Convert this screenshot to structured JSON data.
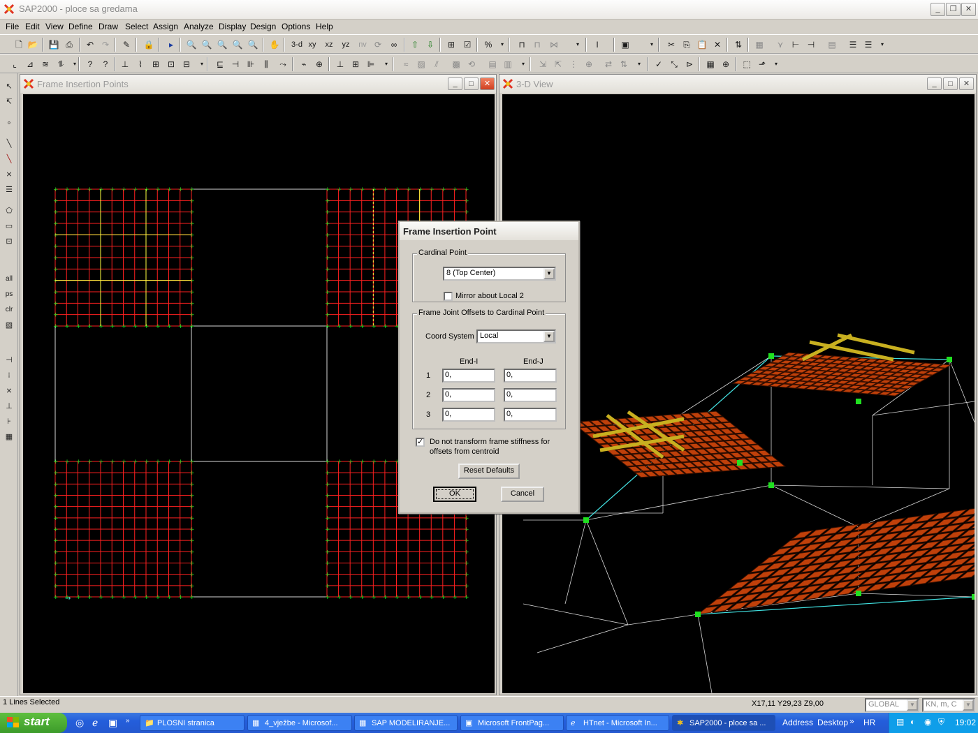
{
  "app": {
    "title": "SAP2000 - ploce sa gredama"
  },
  "menu": [
    "File",
    "Edit",
    "View",
    "Define",
    "Draw",
    "Select",
    "Assign",
    "Analyze",
    "Display",
    "Design",
    "Options",
    "Help"
  ],
  "toolbar1": {
    "view_3d": "3-d",
    "view_xy": "xy",
    "view_xz": "xz",
    "view_yz": "yz",
    "view_nv": "nv"
  },
  "left_toolbar": {
    "all": "all",
    "ps": "ps",
    "clr": "clr"
  },
  "window_left": {
    "title": "Frame Insertion Points"
  },
  "window_right": {
    "title": "3-D View"
  },
  "dialog": {
    "title": "Frame Insertion Point",
    "cardinal_group": "Cardinal Point",
    "cardinal_value": "8 (Top Center)",
    "mirror_label": "Mirror about Local 2",
    "mirror_checked": false,
    "offsets_group": "Frame Joint Offsets to Cardinal Point",
    "coord_label": "Coord System",
    "coord_value": "Local",
    "col_endi": "End-I",
    "col_endj": "End-J",
    "rows": [
      {
        "label": "1",
        "end_i": "0,",
        "end_j": "0,"
      },
      {
        "label": "2",
        "end_i": "0,",
        "end_j": "0,"
      },
      {
        "label": "3",
        "end_i": "0,",
        "end_j": "0,"
      }
    ],
    "transform_label_1": "Do not transform frame stiffness for",
    "transform_label_2": "offsets from centroid",
    "transform_checked": true,
    "reset_label": "Reset Defaults",
    "ok_label": "OK",
    "cancel_label": "Cancel"
  },
  "status": {
    "left": "1 Lines Selected",
    "coords": "X17,11  Y29,23  Z9,00",
    "coord_system": "GLOBAL",
    "units": "KN, m, C"
  },
  "taskbar": {
    "start": "start",
    "tasks": [
      "PLOSNI  stranica",
      "4_vježbe - Microsof...",
      "SAP  MODELIRANJE...",
      "Microsoft FrontPag...",
      "HTnet - Microsoft In...",
      "SAP2000 - ploce sa ..."
    ],
    "address": "Address",
    "desktop": "Desktop",
    "lang": "HR",
    "time": "19:02"
  },
  "colors": {
    "grid_red": "#ff2020",
    "grid_green": "#20e020",
    "grid_yellow": "#ffff40",
    "frame_white": "#d8d8d8",
    "cyan": "#40e0e0"
  }
}
